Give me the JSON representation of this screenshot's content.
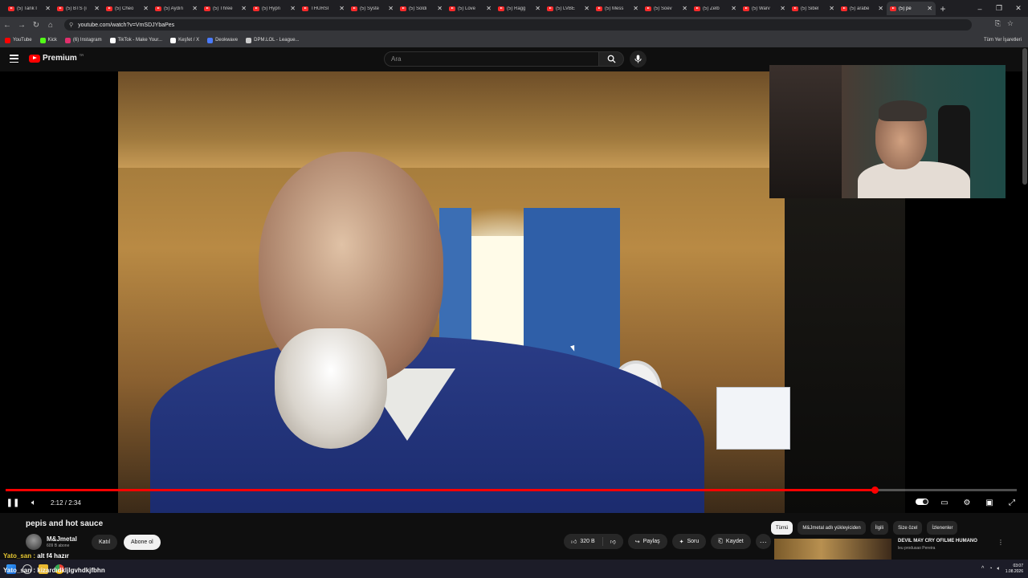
{
  "browser": {
    "tabs": [
      {
        "label": "(5) Tank I"
      },
      {
        "label": "(5) BTS (i"
      },
      {
        "label": "(5) Cheo"
      },
      {
        "label": "(5) Aydın"
      },
      {
        "label": "(5) Three"
      },
      {
        "label": "(5) Hypn"
      },
      {
        "label": "THURSI"
      },
      {
        "label": "(5) Syste"
      },
      {
        "label": "(5) Soldi"
      },
      {
        "label": "(5) Love"
      },
      {
        "label": "(5) Ragg"
      },
      {
        "label": "(5) LVBE"
      },
      {
        "label": "(5) Mess"
      },
      {
        "label": "(5) Soev"
      },
      {
        "label": "(5) Zelb"
      },
      {
        "label": "(5) Warv"
      },
      {
        "label": "(5) Sibel"
      },
      {
        "label": "(5) arabe"
      },
      {
        "label": "(5) pe"
      }
    ],
    "new_tab": "+",
    "window_controls": {
      "minimize": "–",
      "restore": "❐",
      "close": "✕"
    },
    "url": "youtube.com/watch?v=VmSDJYbaPes",
    "bookmarks": [
      {
        "label": "YouTube",
        "color": "#ff0000"
      },
      {
        "label": "Kick",
        "color": "#53fc18"
      },
      {
        "label": "(6) Instagram",
        "color": "#e1306c"
      },
      {
        "label": "TikTok - Make Your...",
        "color": "#ffffff"
      },
      {
        "label": "Keşfet / X",
        "color": "#ffffff"
      },
      {
        "label": "Deokwave",
        "color": "#4a7bff"
      },
      {
        "label": "DPM.LOL - League...",
        "color": "#cccccc"
      }
    ],
    "all_bookmarks": "Tüm Yer İşaretleri"
  },
  "youtube": {
    "logo": "Premium",
    "logo_region": "TR",
    "search_placeholder": "Ara",
    "video": {
      "title": "pepis and hot sauce",
      "time": "2:12 / 2:34",
      "progress_fraction": 0.86
    },
    "channel": {
      "name": "M&Jmetal",
      "subscribers": "609 B abone",
      "join_label": "Katıl",
      "subscribe_label": "Abone ol"
    },
    "actions": {
      "likes": "320 B",
      "share": "Paylaş",
      "ask": "Soru",
      "save": "Kaydet",
      "more": "···"
    },
    "chips": [
      "Tümü",
      "M&Jmetal adlı yükleyiciden",
      "İlgili",
      "Size özel",
      "İzlenenler"
    ],
    "recommendation": {
      "title": "DEVIL MAY CRY OFILME HUMANO",
      "channel": "leu produsao Pereira"
    }
  },
  "chat": {
    "line1_user": "Yato_san :",
    "line1_msg": "alt f4 hazır",
    "line2_user": "Yato_san :",
    "line2_msg": "kizardıdkljlgvhdkjfbhn"
  },
  "taskbar": {
    "time": "03:07",
    "date": "1.08.2026"
  },
  "colors": {
    "accent_red": "#ff0000",
    "chat_user": "#e7c832"
  }
}
